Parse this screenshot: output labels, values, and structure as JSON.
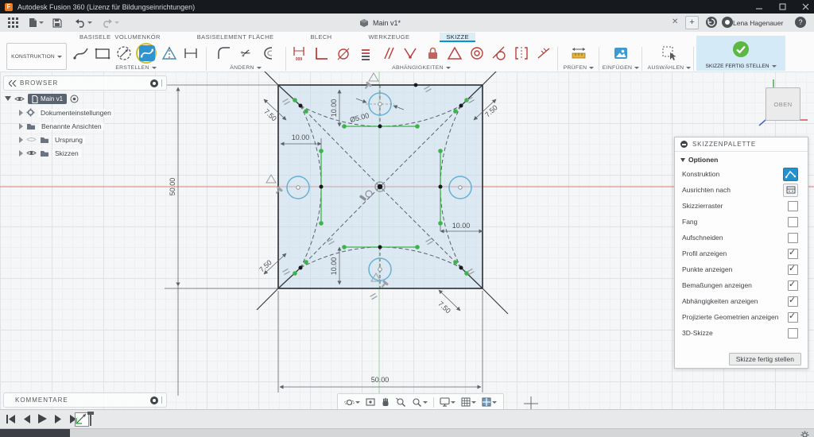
{
  "window": {
    "title": "Autodesk Fusion 360 (Lizenz für Bildungseinrichtungen)",
    "doc_tab": "Main v1*",
    "new_tab_glyph": "+",
    "user": "Lena Hagenauer",
    "help_glyph": "?"
  },
  "ribbon": {
    "tabs": [
      {
        "label": "BASISELE  VOLUMENKÖR",
        "active": false
      },
      {
        "label": "BASISELEMENT FLÄCHE",
        "active": false
      },
      {
        "label": "BLECH",
        "active": false
      },
      {
        "label": "WERKZEUGE",
        "active": false
      },
      {
        "label": "SKIZZE",
        "active": true
      }
    ],
    "konstruktion": "KONSTRUKTION",
    "groups": {
      "erstellen": "ERSTELLEN",
      "aendern": "ÄNDERN",
      "abhaengigkeiten": "ABHÄNGIGKEITEN",
      "pruefen": "PRÜFEN",
      "einfuegen": "EINFÜGEN",
      "auswaehlen": "AUSWÄHLEN",
      "finish": "SKIZZE FERTIG STELLEN"
    },
    "dim_glyph": "999",
    "trim_glyph": "✂"
  },
  "browser": {
    "title": "BROWSER",
    "root": "Main v1",
    "items": [
      "Dokumenteinstellungen",
      "Benannte Ansichten",
      "Ursprung",
      "Skizzen"
    ]
  },
  "palette": {
    "title": "SKIZZENPALETTE",
    "section": "Optionen",
    "rows": [
      {
        "label": "Konstruktion"
      },
      {
        "label": "Ausrichten nach"
      },
      {
        "label": "Skizzierraster",
        "checked": false
      },
      {
        "label": "Fang",
        "checked": false
      },
      {
        "label": "Aufschneiden",
        "checked": false
      },
      {
        "label": "Profil anzeigen",
        "checked": true
      },
      {
        "label": "Punkte anzeigen",
        "checked": true
      },
      {
        "label": "Bemaßungen anzeigen",
        "checked": true
      },
      {
        "label": "Abhängigkeiten anzeigen",
        "checked": true
      },
      {
        "label": "Projizierte Geometrien anzeigen",
        "checked": true
      },
      {
        "label": "3D-Skizze",
        "checked": false
      }
    ],
    "finish_button": "Skizze fertig stellen"
  },
  "viewcube": {
    "face": "OBEN"
  },
  "comments": {
    "title": "KOMMENTARE"
  },
  "sketch": {
    "dims": {
      "width": "50.00",
      "height": "50.00",
      "offset": "10.00",
      "corner": "7.50",
      "diameter": "Ø5.00"
    }
  },
  "colors": {
    "accent_blue": "#0696d7",
    "constraint_red": "#b9413c",
    "point_green": "#3cb44b",
    "axis_red": "#e07d72",
    "axis_green": "#9fd3a0",
    "finish_green": "#5cb841",
    "profile_fill": "#cae0f0"
  }
}
